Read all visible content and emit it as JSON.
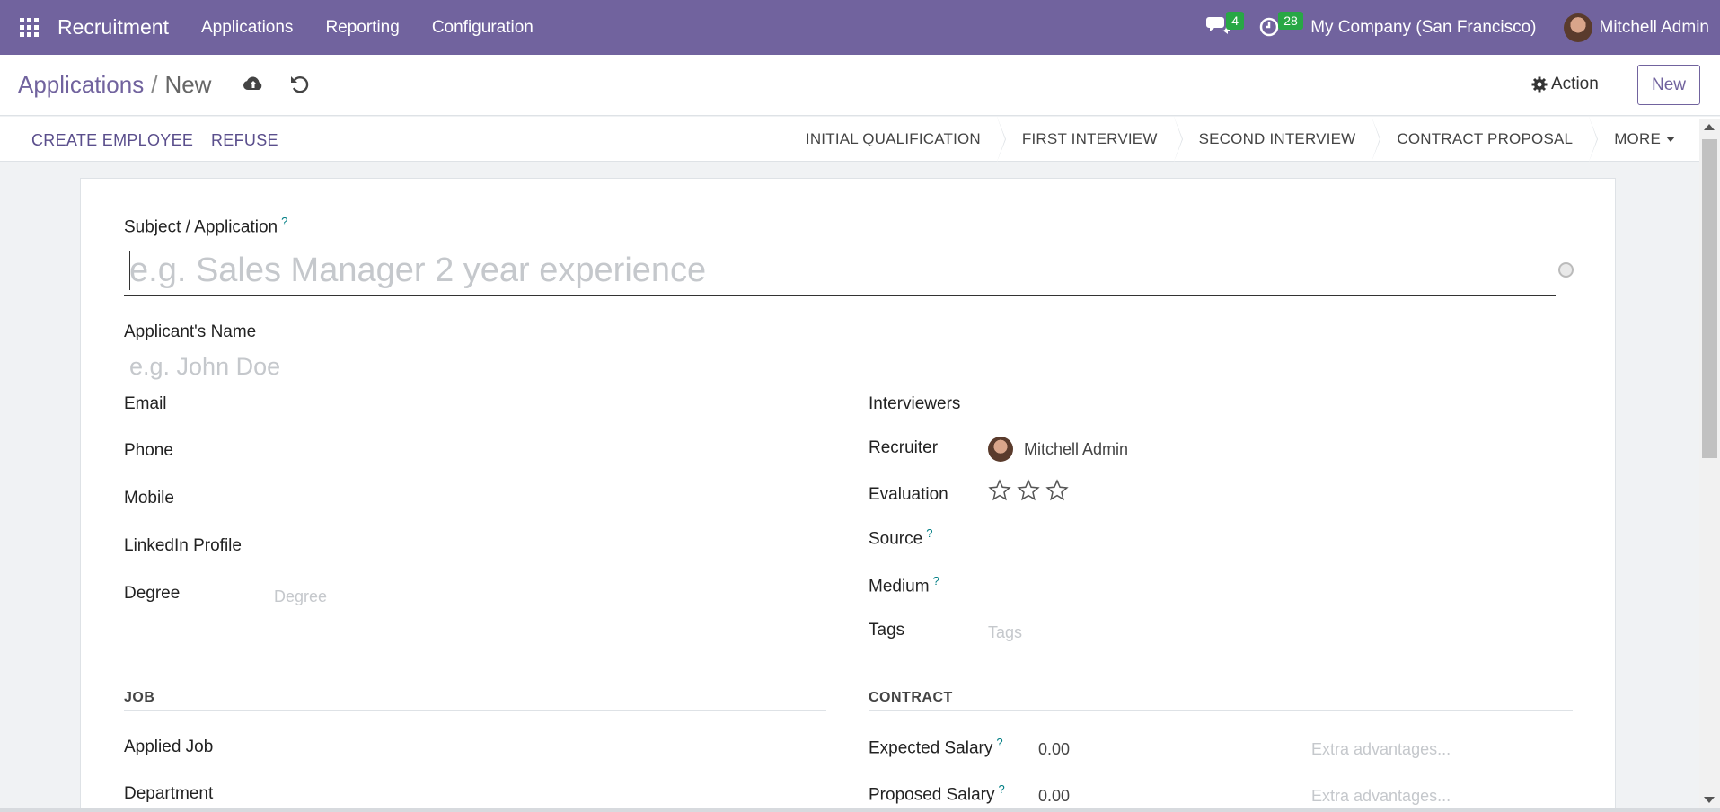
{
  "nav": {
    "brand": "Recruitment",
    "menu": [
      "Applications",
      "Reporting",
      "Configuration"
    ],
    "messages_count": "4",
    "activities_count": "28",
    "company": "My Company (San Francisco)",
    "user": "Mitchell Admin"
  },
  "control": {
    "breadcrumb_parent": "Applications",
    "breadcrumb_sep": "/",
    "breadcrumb_current": "New",
    "action_label": "Action",
    "new_label": "New"
  },
  "statusbar": {
    "create_employee": "CREATE EMPLOYEE",
    "refuse": "REFUSE",
    "stages": [
      "INITIAL QUALIFICATION",
      "FIRST INTERVIEW",
      "SECOND INTERVIEW",
      "CONTRACT PROPOSAL"
    ],
    "more": "MORE"
  },
  "form": {
    "subject_label": "Subject / Application",
    "subject_placeholder": "e.g. Sales Manager 2 year experience",
    "applicant_name_label": "Applicant's Name",
    "applicant_name_placeholder": "e.g. John Doe",
    "email_label": "Email",
    "phone_label": "Phone",
    "mobile_label": "Mobile",
    "linkedin_label": "LinkedIn Profile",
    "degree_label": "Degree",
    "degree_placeholder": "Degree",
    "interviewers_label": "Interviewers",
    "recruiter_label": "Recruiter",
    "recruiter_value": "Mitchell Admin",
    "evaluation_label": "Evaluation",
    "evaluation_stars": 0,
    "source_label": "Source",
    "medium_label": "Medium",
    "tags_label": "Tags",
    "tags_placeholder": "Tags",
    "help_mark": "?"
  },
  "job": {
    "section_title": "JOB",
    "applied_job_label": "Applied Job",
    "department_label": "Department"
  },
  "contract": {
    "section_title": "CONTRACT",
    "expected_salary_label": "Expected Salary",
    "expected_salary_value": "0.00",
    "expected_extra_placeholder": "Extra advantages...",
    "proposed_salary_label": "Proposed Salary",
    "proposed_salary_value": "0.00",
    "proposed_extra_placeholder": "Extra advantages..."
  },
  "colors": {
    "brand": "#71639e",
    "badge": "#28a745",
    "help": "#017e84"
  }
}
